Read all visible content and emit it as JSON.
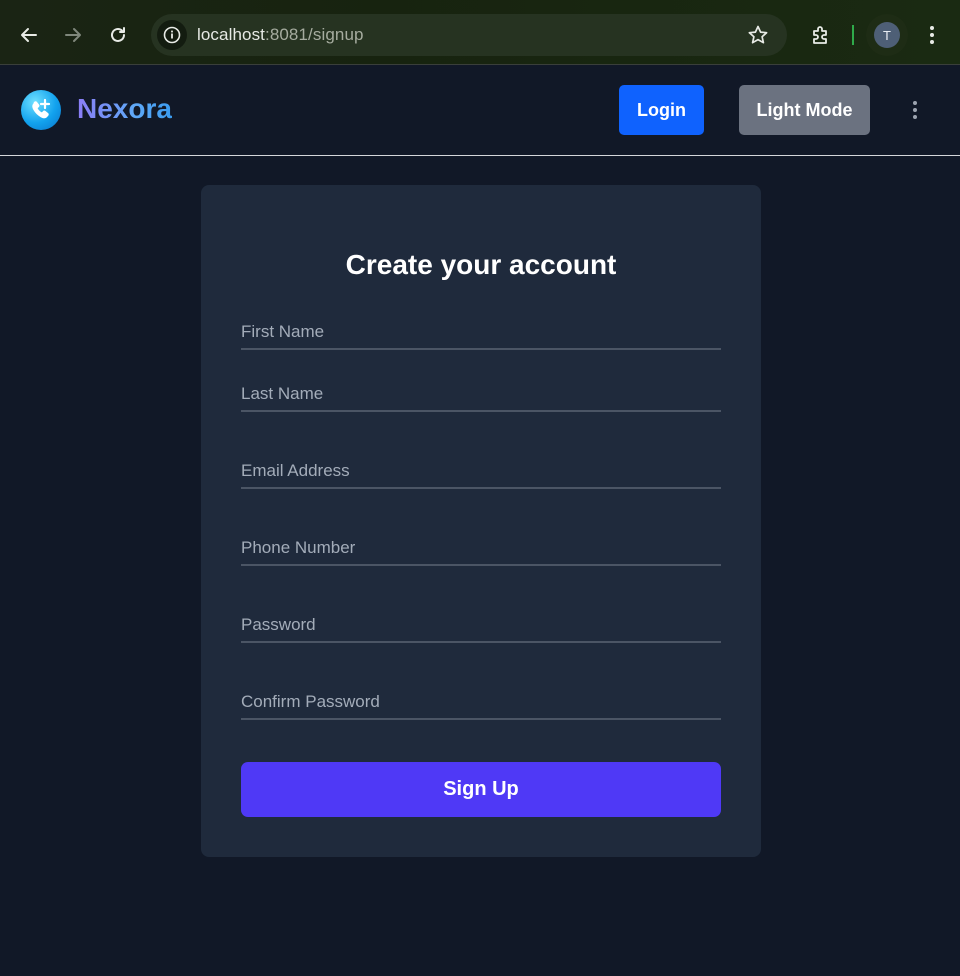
{
  "browser": {
    "url_host": "localhost",
    "url_path": ":8081/signup",
    "profile_initial": "T",
    "icons": {
      "back": "arrow-left-icon",
      "forward": "arrow-right-icon",
      "reload": "reload-icon",
      "site_info": "info-icon",
      "bookmark": "star-icon",
      "extensions": "puzzle-icon",
      "menu": "kebab-menu-icon"
    }
  },
  "navbar": {
    "brand": "Nexora",
    "logo_icon": "phone-plus-icon",
    "login_label": "Login",
    "theme_label": "Light Mode",
    "menu_icon": "kebab-menu-icon"
  },
  "signup": {
    "title": "Create your account",
    "fields": {
      "first_name": "First Name",
      "last_name": "Last Name",
      "email": "Email Address",
      "phone": "Phone Number",
      "password": "Password",
      "confirm_password": "Confirm Password"
    },
    "submit_label": "Sign Up"
  },
  "colors": {
    "page_bg": "#111827",
    "card_bg": "#1f2a3c",
    "login_button": "#0f62fe",
    "theme_button": "#6b7280",
    "signup_button": "#4f39f6"
  }
}
